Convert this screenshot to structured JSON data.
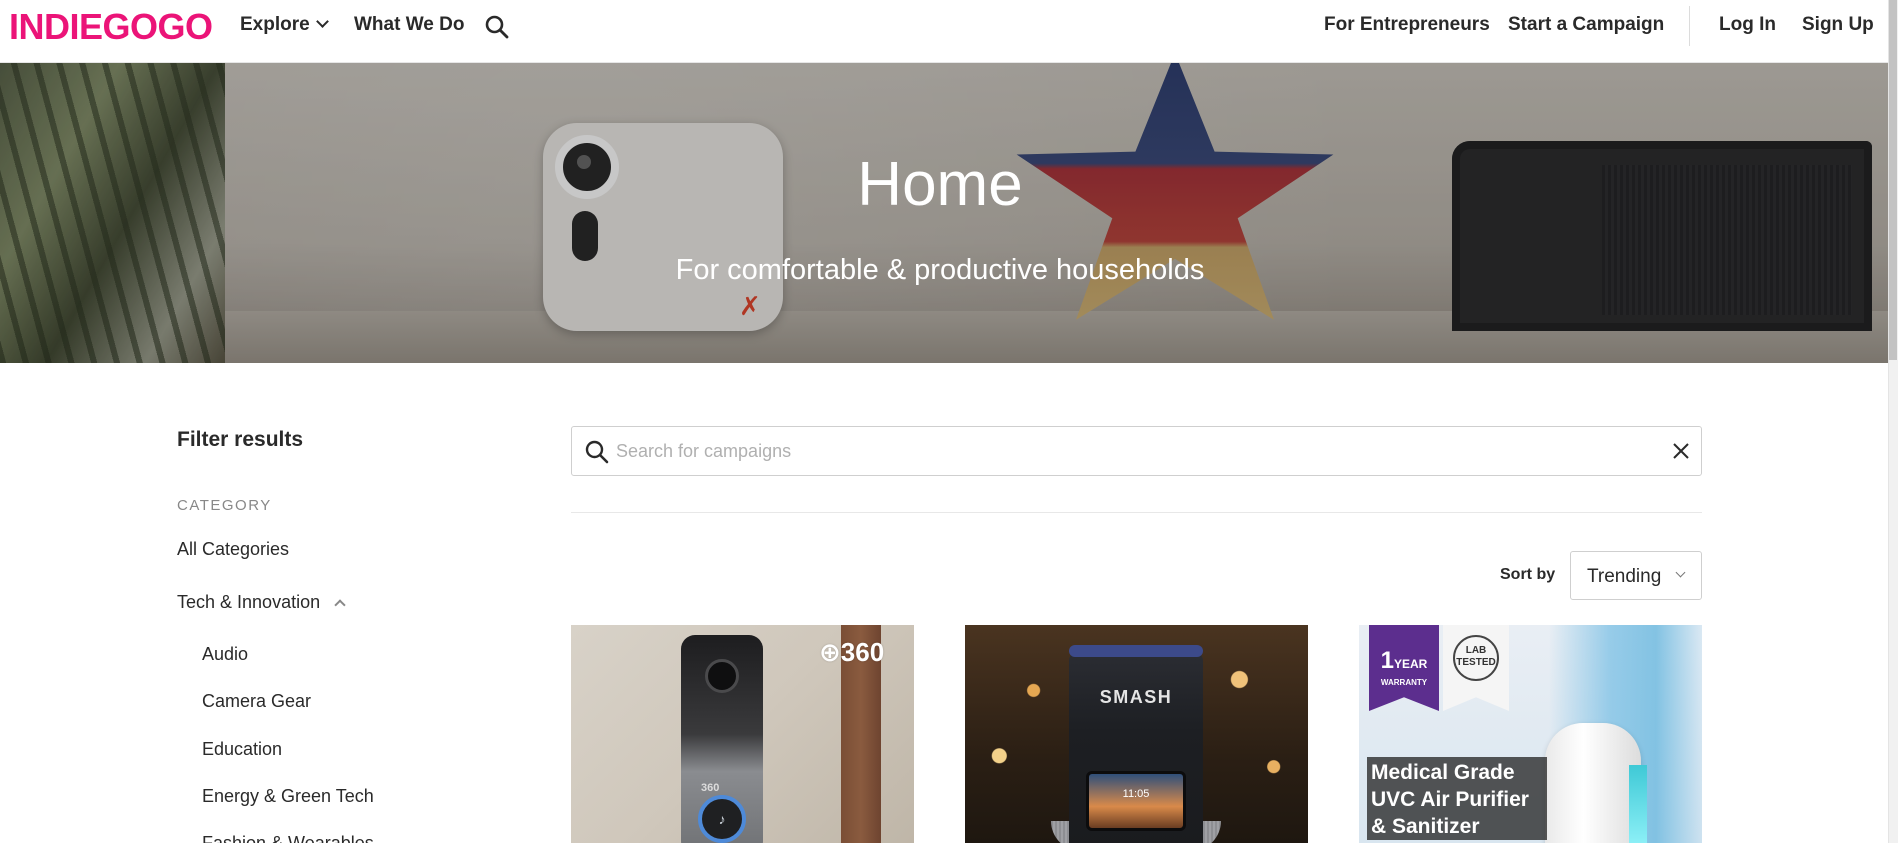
{
  "header": {
    "logo": "INDIEGOGO",
    "explore_label": "Explore",
    "what_we_do_label": "What We Do",
    "for_entrepreneurs_label": "For Entrepreneurs",
    "start_campaign_label": "Start a Campaign",
    "login_label": "Log In",
    "signup_label": "Sign Up"
  },
  "hero": {
    "title": "Home",
    "subtitle": "For comfortable & productive households"
  },
  "filters": {
    "title": "Filter results",
    "category_label": "CATEGORY",
    "all_categories": "All Categories",
    "tech_innovation": "Tech & Innovation",
    "subcategories": [
      "Audio",
      "Camera Gear",
      "Education",
      "Energy & Green Tech",
      "Fashion & Wearables"
    ]
  },
  "search": {
    "placeholder": "Search for campaigns",
    "value": ""
  },
  "sort": {
    "label": "Sort by",
    "value": "Trending"
  },
  "cards": [
    {
      "brand_text": "360",
      "device_text": "360"
    },
    {
      "brand_text": "SMASH",
      "screen_time": "11:05"
    },
    {
      "warranty_number": "1",
      "warranty_unit": "YEAR",
      "warranty_text": "WARRANTY",
      "lab_text": "LAB TESTED",
      "headline": "Medical Grade UVC Air Purifier & Sanitizer"
    }
  ],
  "colors": {
    "brand": "#eb1478",
    "text": "#2a2a2a",
    "muted": "#888888"
  }
}
